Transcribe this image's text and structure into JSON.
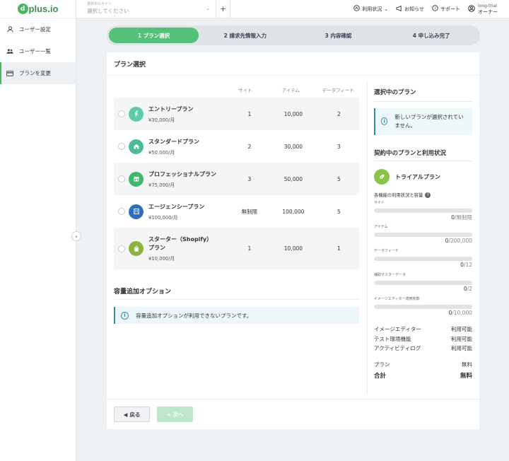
{
  "brand": {
    "logo_mark": "d",
    "logo_text": "plus.io"
  },
  "sidebar": {
    "items": [
      {
        "label": "ユーザー設定",
        "icon": "user-icon"
      },
      {
        "label": "ユーザー一覧",
        "icon": "users-icon"
      },
      {
        "label": "プランを変更",
        "icon": "card-icon",
        "active": true
      }
    ]
  },
  "topbar": {
    "site_select_label": "選択中のサイト",
    "site_select_value": "選択してください",
    "add_label": "+",
    "usage": "利用状況",
    "notice": "お知らせ",
    "support": "サポート",
    "user_name": "long-trial",
    "user_role": "オーナー"
  },
  "steps": [
    "1 プラン選択",
    "2 請求先情報入力",
    "3 内容確認",
    "4 申し込み完了"
  ],
  "main": {
    "title": "プラン選択",
    "columns": [
      "サイト",
      "アイテム",
      "データフィード"
    ],
    "plans": [
      {
        "name": "エントリープラン",
        "price": "¥30,000/月",
        "sites": "1",
        "items": "10,000",
        "feeds": "2",
        "icon": "walk-icon",
        "color": "#5dcca6"
      },
      {
        "name": "スタンダードプラン",
        "price": "¥50,000/月",
        "sites": "2",
        "items": "30,000",
        "feeds": "3",
        "icon": "home-icon",
        "color": "#4dbb96"
      },
      {
        "name": "プロフェッショナルプラン",
        "price": "¥75,000/月",
        "sites": "3",
        "items": "50,000",
        "feeds": "5",
        "icon": "store-icon",
        "color": "#3eb86a"
      },
      {
        "name": "エージェンシープラン",
        "price": "¥100,000/月",
        "sites": "無制限",
        "items": "100,000",
        "feeds": "5",
        "icon": "building-icon",
        "color": "#2f6fbf"
      },
      {
        "name_line1": "スターター（Shopify）",
        "name_line2": "プラン",
        "price": "¥10,000/月",
        "sites": "1",
        "items": "10,000",
        "feeds": "1",
        "icon": "shopify-bag-icon",
        "color": "#8cb43c"
      }
    ],
    "options_title": "容量追加オプション",
    "options_info": "容量追加オプションが利用できないプランです。",
    "back_label": "戻る",
    "next_label": "次へ"
  },
  "right_panel": {
    "selected_title": "選択中のプラン",
    "selected_info": "新しいプランが選択されていません。",
    "current_title": "契約中のプランと利用状況",
    "current_plan": "トライアルプラン",
    "usage_head": "各機能の利用状況と容量",
    "usage": [
      {
        "label": "サイト",
        "used": "0",
        "max": "無制限",
        "fraction": 0
      },
      {
        "label": "アイテム",
        "used": "0",
        "max": "200,000",
        "fraction": 0
      },
      {
        "label": "データフィード",
        "used": "0",
        "max": "12",
        "fraction": 0
      },
      {
        "label": "補助マスターデータ",
        "used": "0",
        "max": "2",
        "fraction": 0
      },
      {
        "label": "イメージエディター適用枚数",
        "used": "0",
        "max": "10,000",
        "fraction": 0
      }
    ],
    "features": [
      {
        "name": "イメージエディター",
        "status": "利用可能"
      },
      {
        "name": "テスト環境機能",
        "status": "利用可能"
      },
      {
        "name": "アクティビティログ",
        "status": "利用可能"
      }
    ],
    "plan_label": "プラン",
    "plan_value": "無料",
    "total_label": "合計",
    "total_value": "無料"
  },
  "colors": {
    "accent": "#54c17a",
    "info": "#2d8fa5"
  }
}
